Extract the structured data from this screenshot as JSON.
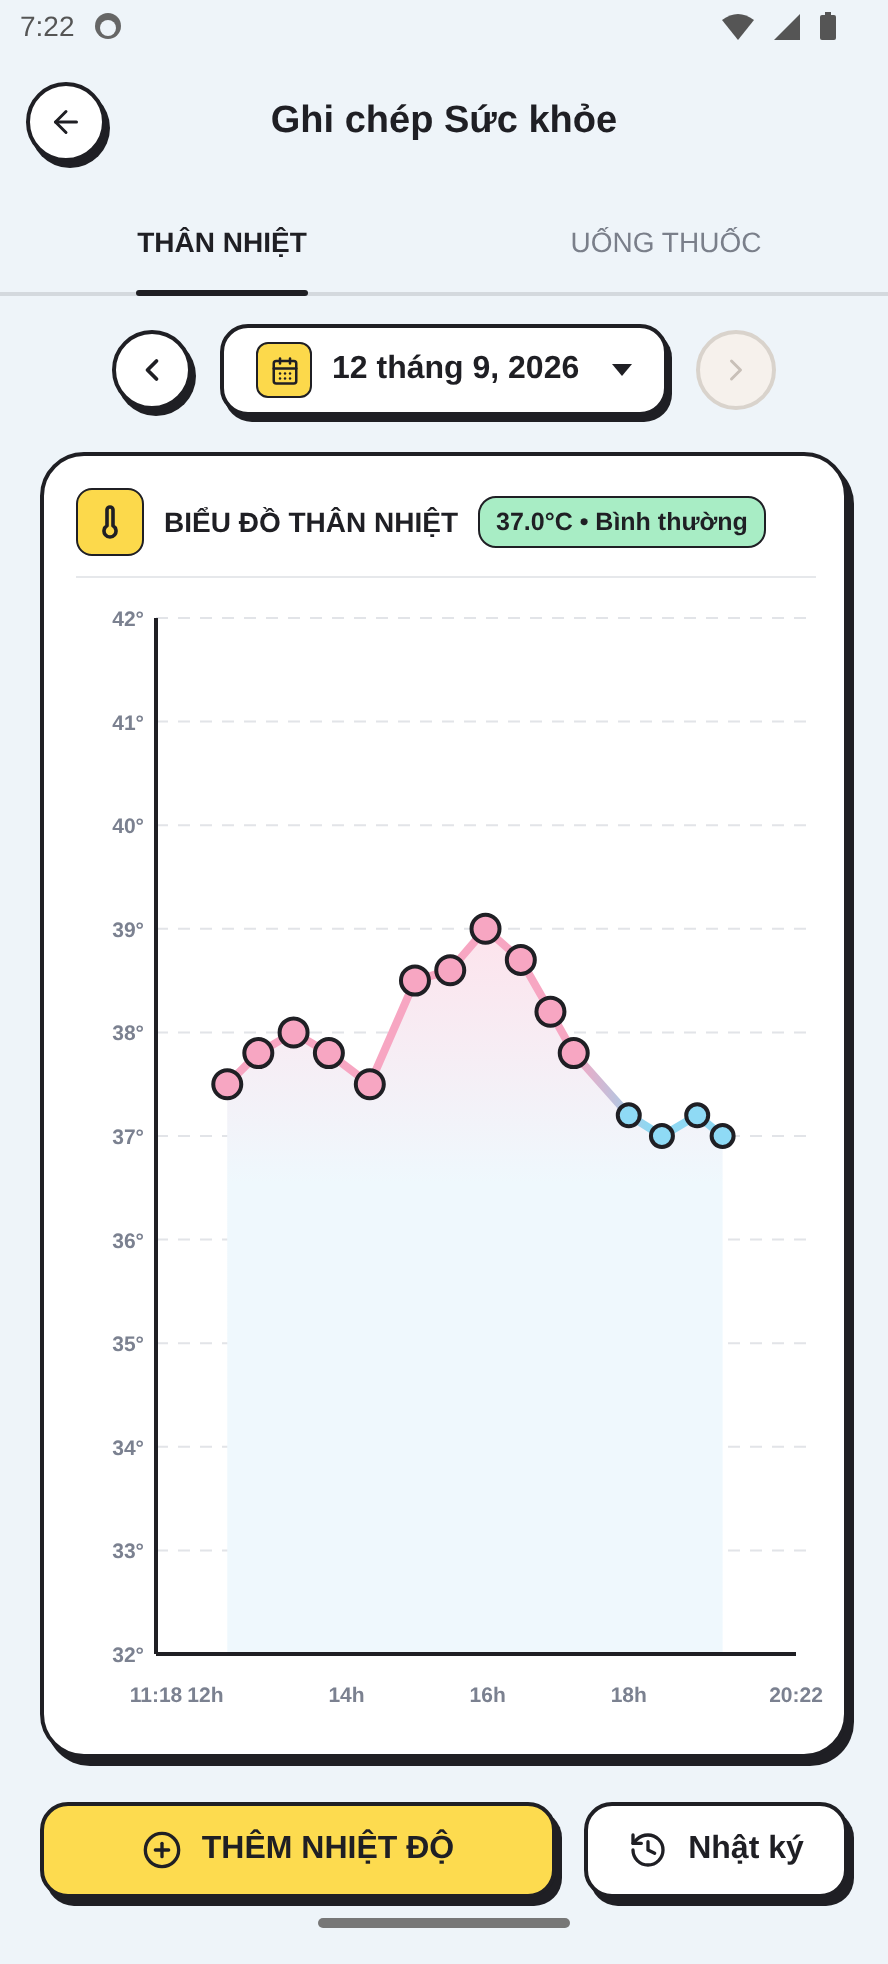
{
  "status_bar": {
    "time": "7:22"
  },
  "header": {
    "title": "Ghi chép Sức khỏe"
  },
  "tabs": [
    {
      "label": "THÂN NHIỆT",
      "selected": true
    },
    {
      "label": "UỐNG THUỐC",
      "selected": false
    }
  ],
  "date_picker": {
    "date": "12 tháng 9, 2026",
    "next_disabled": true
  },
  "chart_card": {
    "title": "BIỂU ĐỒ THÂN NHIỆT",
    "badge": "37.0°C • Bình thường",
    "chart_data": {
      "type": "line",
      "x": [
        12.31,
        12.75,
        13.25,
        13.75,
        14.33,
        14.97,
        15.47,
        15.97,
        16.47,
        16.89,
        17.22,
        18.0,
        18.47,
        18.97,
        19.33
      ],
      "grid": true,
      "series": [
        {
          "marker": "o",
          "color": "#f7a6c2",
          "values": [
            37.5,
            37.8,
            38.0,
            37.8,
            37.5,
            38.5,
            38.6,
            39.0,
            38.7,
            38.2,
            37.8,
            37.2,
            37.0,
            37.2,
            37.0
          ]
        }
      ],
      "xlim": [
        11.3,
        20.37
      ],
      "ylim": [
        32,
        42
      ],
      "xticks": [
        {
          "value": 11.3,
          "label": "11:18"
        },
        {
          "value": 12,
          "label": "12h"
        },
        {
          "value": 14,
          "label": "14h"
        },
        {
          "value": 16,
          "label": "16h"
        },
        {
          "value": 18,
          "label": "18h"
        },
        {
          "value": 20.37,
          "label": "20:22"
        }
      ],
      "yticks": [
        {
          "value": 32,
          "label": "32°"
        },
        {
          "value": 33,
          "label": "33°"
        },
        {
          "value": 34,
          "label": "34°"
        },
        {
          "value": 35,
          "label": "35°"
        },
        {
          "value": 36,
          "label": "36°"
        },
        {
          "value": 37,
          "label": "37°"
        },
        {
          "value": 38,
          "label": "38°"
        },
        {
          "value": 39,
          "label": "39°"
        },
        {
          "value": 40,
          "label": "40°"
        },
        {
          "value": 41,
          "label": "41°"
        },
        {
          "value": 42,
          "label": "42°"
        }
      ]
    }
  },
  "buttons": [
    {
      "kind": "primary",
      "label": "THÊM NHIỆT ĐỘ"
    },
    {
      "kind": "secondary",
      "label": "Nhật ký"
    }
  ]
}
